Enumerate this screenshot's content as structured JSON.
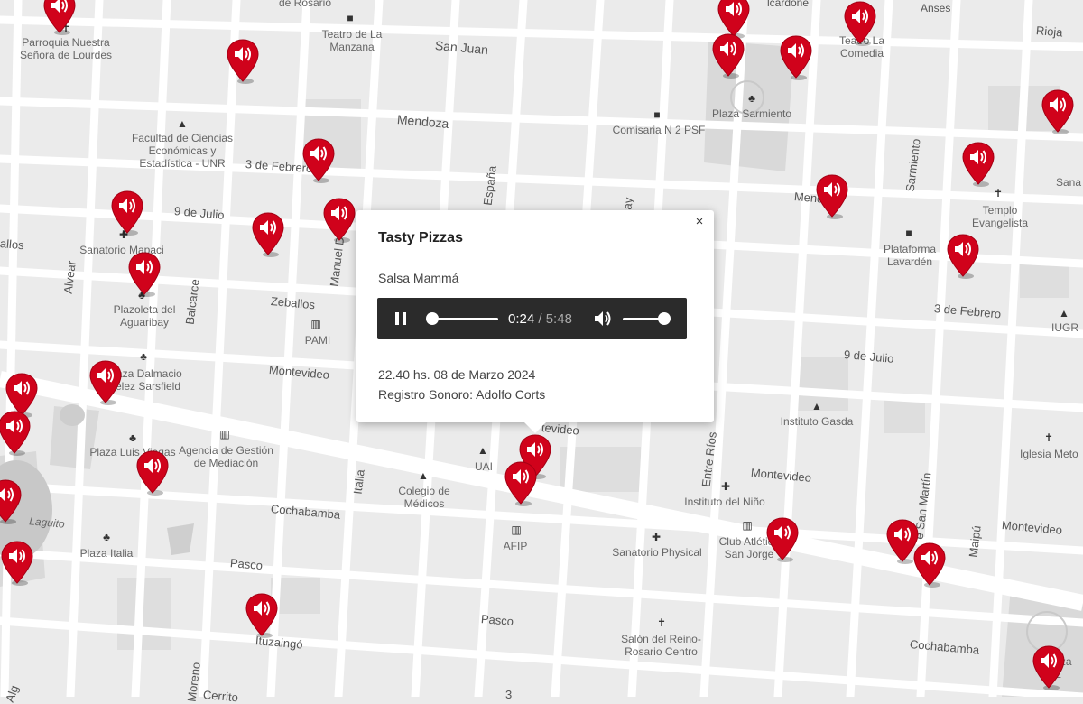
{
  "popup": {
    "title": "Tasty Pizzas",
    "subtitle": "Salsa Mammá",
    "close_glyph": "×",
    "player": {
      "current": "0:24",
      "separator": " / ",
      "duration": "5:48",
      "progress_fraction": 0.069,
      "volume_fraction": 1.0
    },
    "date_line": "22.40 hs. 08 de Marzo 2024",
    "credit_line": "Registro Sonoro: Adolfo Corts"
  },
  "colors": {
    "marker": "#d0021b",
    "map_background": "#ebebeb",
    "road": "#ffffff",
    "block": "#dcdcdc",
    "player_background": "#2b2b2b"
  },
  "streets": {
    "san_juan": "San Juan",
    "mendoza": "Mendoza",
    "mendoza_right": "Mendoza",
    "tres_febrero": "3 de Febrero",
    "tres_febrero_right": "3 de Febrero",
    "nueve_julio": "9 de Julio",
    "nueve_julio_right": "9 de Julio",
    "zeballos": "Zeballos",
    "montevideo": "Montevideo",
    "montevideo_mid": "Montevideo",
    "montevideo_right": "Montevideo",
    "montevideo_popup": "tevideo",
    "cochabamba": "Cochabamba",
    "cochabamba_right": "Cochabamba",
    "pasco": "Pasco",
    "pasco_right": "Pasco",
    "ituzaingo": "Ituzaingó",
    "alvear": "Alvear",
    "balcarce": "Balcarce",
    "espana": "España",
    "manuel_d": "Manuel D",
    "italia": "Italia",
    "entre_rios": "Entre Ríos",
    "sarmiento": "Sarmiento",
    "maipu": "Maipú",
    "san_martin": "e San Martín",
    "ayuay": "uay",
    "moreno": "Moreno",
    "rioja": "Rioja",
    "anses": "Anses",
    "ballos": "allos",
    "lcardone": "lcardone",
    "cerrito": "Cerrito",
    "alg": "Alg",
    "bottom_partial": "3"
  },
  "places": {
    "parroquia": "Parroquia Nuestra\nSeñora de Lourdes",
    "de_rosario": "de Rosario",
    "teatro_manzana": "Teatro de La\nManzana",
    "teatro_comedia": "Teatro La\nComedia",
    "plaza_sarmiento": "Plaza Sarmiento",
    "comisaria": "Comisaria N 2 PSF",
    "facultad": "Facultad de Ciencias\nEconómicas y\nEstadística - UNR",
    "sanatorio_mapaci": "Sanatorio Mapaci",
    "plazoleta_aguaribay": "Plazoleta del\nAguaribay",
    "pami": "PAMI",
    "plaza_dalmacio": "Plaza Dalmacio\nVélez Sarsfield",
    "plaza_luis": "Plaza Luis Viegas",
    "agencia": "Agencia de Gestión\nde Mediación",
    "uai": "UAI",
    "colegio_medicos": "Colegio de\nMédicos",
    "afip": "AFIP",
    "instituto_nino": "Instituto del Niño",
    "instituto_gasda": "Instituto Gasda",
    "sanatorio_physical": "Sanatorio Physical",
    "club_san_jorge": "Club Atlético\nSan Jorge",
    "templo": "Templo\nEvangelista",
    "plataforma": "Plataforma\nLavardén",
    "iugr": "IUGR",
    "iglesia_meto": "Iglesia Meto",
    "plaza_italia": "Plaza Italia",
    "laguito": "Laguito",
    "salon_reino": "Salón del Reino-\nRosario Centro",
    "plaza_right": "Plaza\nL",
    "sana": "Sana"
  }
}
